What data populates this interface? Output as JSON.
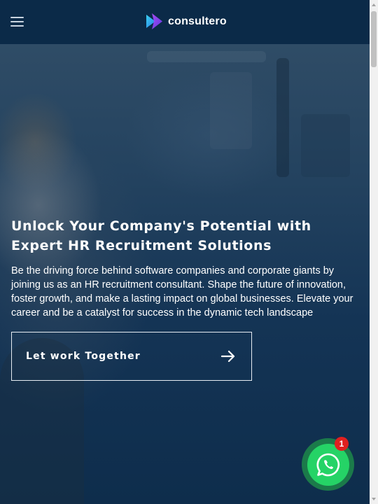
{
  "header": {
    "brand_name": "consultero",
    "menu_icon": "hamburger-menu-icon",
    "logo_icon": "consultero-logo-icon"
  },
  "hero": {
    "title_line1": "Unlock Your Company's Potential with",
    "title_line2": "Expert HR Recruitment Solutions",
    "description": "Be the driving force behind software companies and corporate giants by joining us as an HR recruitment consultant. Shape the future of innovation, foster growth, and make a lasting impact on global businesses. Elevate your career and be a catalyst for success in the dynamic tech landscape",
    "cta_label": "Let work Together",
    "cta_icon": "arrow-right-icon"
  },
  "whatsapp": {
    "icon": "whatsapp-icon",
    "badge_count": "1"
  },
  "colors": {
    "header_bg": "#0b2a48",
    "hero_overlay": "#0e2d4c",
    "whatsapp_green": "#25d366",
    "badge_red": "#e0201f"
  }
}
